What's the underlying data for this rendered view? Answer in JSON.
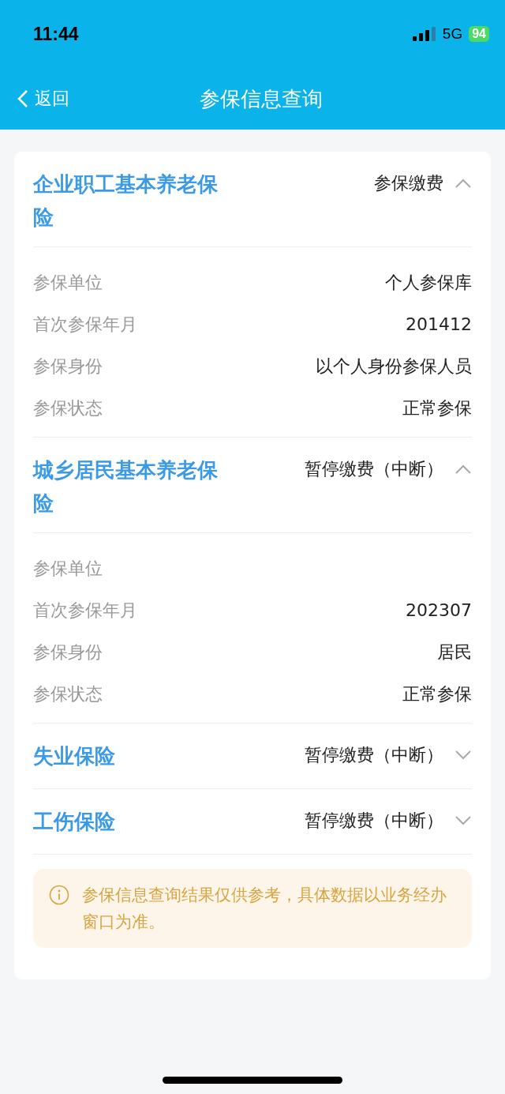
{
  "status_bar": {
    "time": "11:44",
    "network": "5G",
    "battery": "94"
  },
  "nav": {
    "back": "返回",
    "title": "参保信息查询"
  },
  "sections": [
    {
      "title": "企业职工基本养老保险",
      "status": "参保缴费",
      "expanded": true,
      "fields": [
        {
          "label": "参保单位",
          "value": "个人参保库"
        },
        {
          "label": "首次参保年月",
          "value": "201412"
        },
        {
          "label": "参保身份",
          "value": "以个人身份参保人员"
        },
        {
          "label": "参保状态",
          "value": "正常参保"
        }
      ]
    },
    {
      "title": "城乡居民基本养老保险",
      "status": "暂停缴费（中断）",
      "expanded": true,
      "fields": [
        {
          "label": "参保单位"
        },
        {
          "label": "首次参保年月",
          "value": "202307"
        },
        {
          "label": "参保身份",
          "value": "居民"
        },
        {
          "label": "参保状态",
          "value": "正常参保"
        }
      ]
    },
    {
      "title": "失业保险",
      "status": "暂停缴费（中断）",
      "expanded": false
    },
    {
      "title": "工伤保险",
      "status": "暂停缴费（中断）",
      "expanded": false
    }
  ],
  "notice": "参保信息查询结果仅供参考，具体数据以业务经办窗口为准。"
}
